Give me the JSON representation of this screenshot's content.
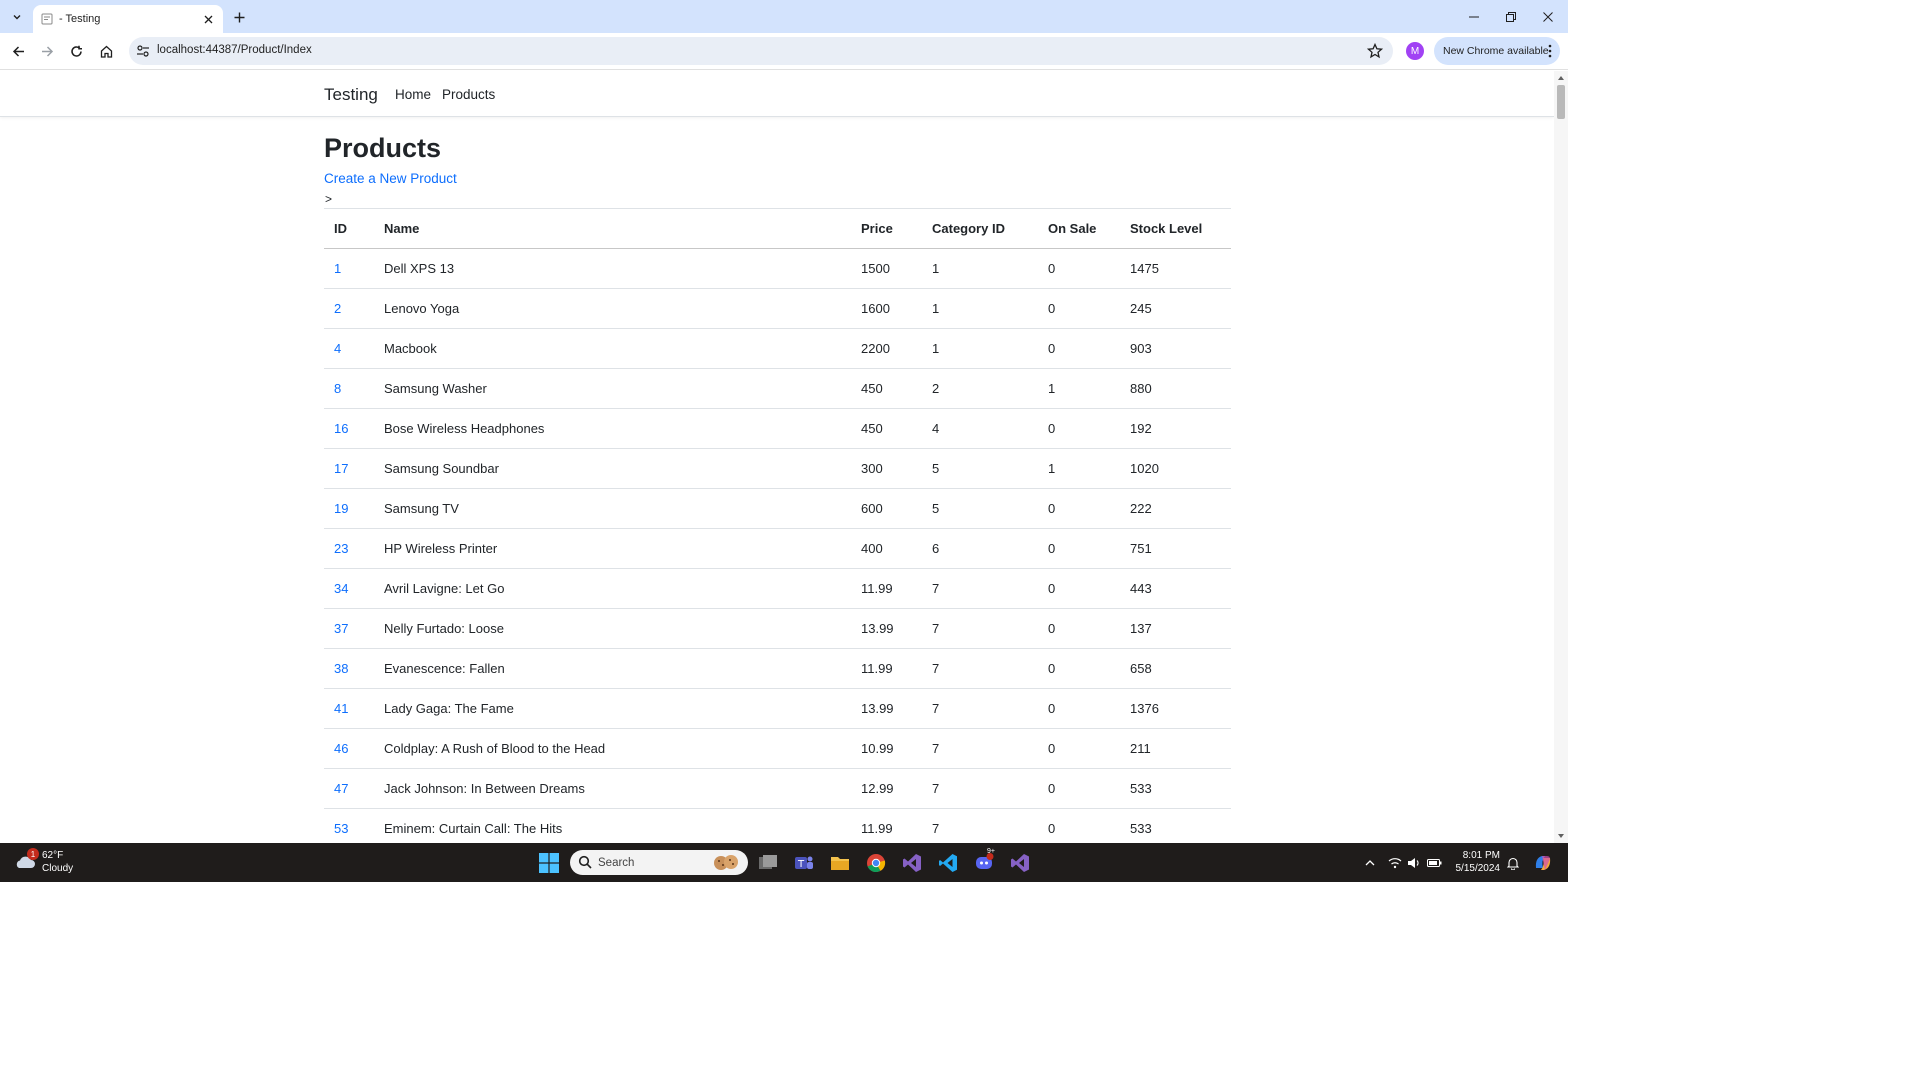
{
  "browser": {
    "tab_title": "- Testing",
    "url": "localhost:44387/Product/Index",
    "profile_initial": "M",
    "update_label": "New Chrome available"
  },
  "app": {
    "brand": "Testing",
    "nav": [
      "Home",
      "Products"
    ]
  },
  "page": {
    "title": "Products",
    "create_link": "Create a New Product",
    "stray_text": ">"
  },
  "table": {
    "headers": [
      "ID",
      "Name",
      "Price",
      "Category ID",
      "On Sale",
      "Stock Level"
    ],
    "rows": [
      [
        "1",
        "Dell XPS 13",
        "1500",
        "1",
        "0",
        "1475"
      ],
      [
        "2",
        "Lenovo Yoga",
        "1600",
        "1",
        "0",
        "245"
      ],
      [
        "4",
        "Macbook",
        "2200",
        "1",
        "0",
        "903"
      ],
      [
        "8",
        "Samsung Washer",
        "450",
        "2",
        "1",
        "880"
      ],
      [
        "16",
        "Bose Wireless Headphones",
        "450",
        "4",
        "0",
        "192"
      ],
      [
        "17",
        "Samsung Soundbar",
        "300",
        "5",
        "1",
        "1020"
      ],
      [
        "19",
        "Samsung TV",
        "600",
        "5",
        "0",
        "222"
      ],
      [
        "23",
        "HP Wireless Printer",
        "400",
        "6",
        "0",
        "751"
      ],
      [
        "34",
        "Avril Lavigne: Let Go",
        "11.99",
        "7",
        "0",
        "443"
      ],
      [
        "37",
        "Nelly Furtado: Loose",
        "13.99",
        "7",
        "0",
        "137"
      ],
      [
        "38",
        "Evanescence: Fallen",
        "11.99",
        "7",
        "0",
        "658"
      ],
      [
        "41",
        "Lady Gaga: The Fame",
        "13.99",
        "7",
        "0",
        "1376"
      ],
      [
        "46",
        "Coldplay: A Rush of Blood to the Head",
        "10.99",
        "7",
        "0",
        "211"
      ],
      [
        "47",
        "Jack Johnson: In Between Dreams",
        "12.99",
        "7",
        "0",
        "533"
      ],
      [
        "53",
        "Eminem: Curtain Call: The Hits",
        "11.99",
        "7",
        "0",
        "533"
      ]
    ]
  },
  "taskbar": {
    "weather_badge": "1",
    "weather_temp": "62°F",
    "weather_desc": "Cloudy",
    "search_placeholder": "Search",
    "discord_badge": "9+",
    "time": "8:01 PM",
    "date": "5/15/2024"
  },
  "colors": {
    "link": "#0d6efd",
    "tabbar": "#d3e3fd",
    "taskbar": "#1f1c1b"
  }
}
